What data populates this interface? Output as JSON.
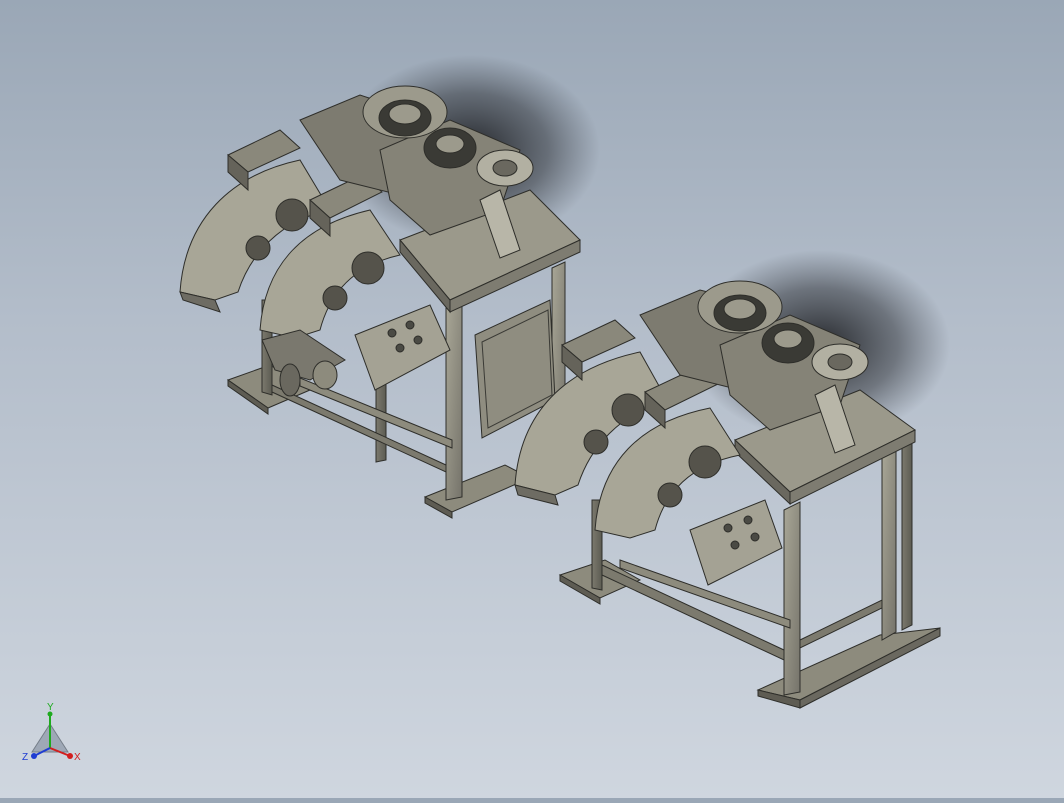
{
  "scene": {
    "description_free": true,
    "background_top": "#9aa7b6",
    "background_bottom": "#cfd6df",
    "model_color": "#8d8b7d",
    "edge_color": "#2e2e2a"
  },
  "triad": {
    "x_label": "X",
    "y_label": "Y",
    "z_label": "Z",
    "x_color": "#d21e1e",
    "y_color": "#1eaa1e",
    "z_color": "#1e3cd2"
  }
}
